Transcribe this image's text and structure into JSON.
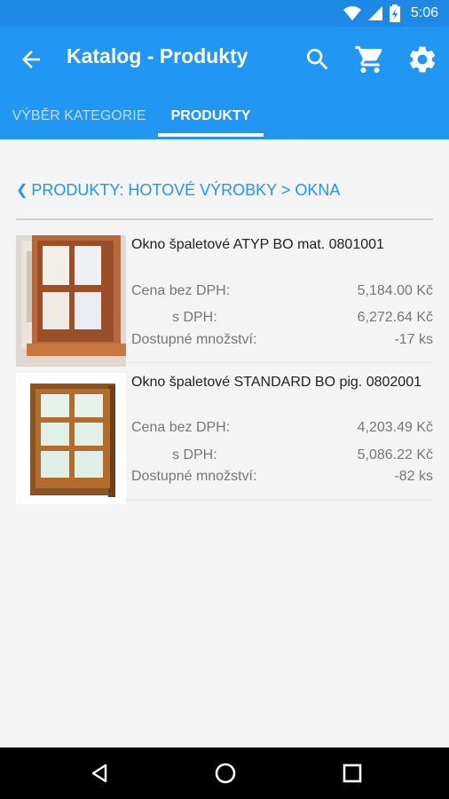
{
  "status_bar": {
    "time": "5:06",
    "icons": [
      "wifi-icon",
      "signal-icon",
      "battery-icon"
    ]
  },
  "app_bar": {
    "title": "Katalog - Produkty",
    "actions": [
      "search-icon",
      "cart-icon",
      "settings-icon"
    ]
  },
  "tabs": [
    {
      "label": "VÝBĚR KATEGORIE",
      "active": false
    },
    {
      "label": "PRODUKTY",
      "active": true
    }
  ],
  "breadcrumb": {
    "text": "PRODUKTY: HOTOVÉ VÝROBKY > OKNA"
  },
  "products": [
    {
      "name": "Okno špaletové ATYP BO mat. 0801001",
      "price_label_1": "Cena  bez DPH:",
      "price_without_vat": "5,184.00 Kč",
      "price_label_2": "s DPH:",
      "price_with_vat": "6,272.64 Kč",
      "qty_label": "Dostupné množství:",
      "qty": "-17 ks"
    },
    {
      "name": "Okno špaletové STANDARD BO pig. 0802001",
      "price_label_1": "Cena  bez DPH:",
      "price_without_vat": "4,203.49 Kč",
      "price_label_2": "s DPH:",
      "price_with_vat": "5,086.22 Kč",
      "qty_label": "Dostupné množství:",
      "qty": "-82 ks"
    }
  ],
  "nav_bar": {
    "buttons": [
      "back-triangle-icon",
      "home-circle-icon",
      "recents-square-icon"
    ]
  },
  "colors": {
    "primary": "#2196f3",
    "primary_dark": "#1e88e5",
    "link": "#2196f3",
    "text": "#222222",
    "muted": "#777777"
  }
}
